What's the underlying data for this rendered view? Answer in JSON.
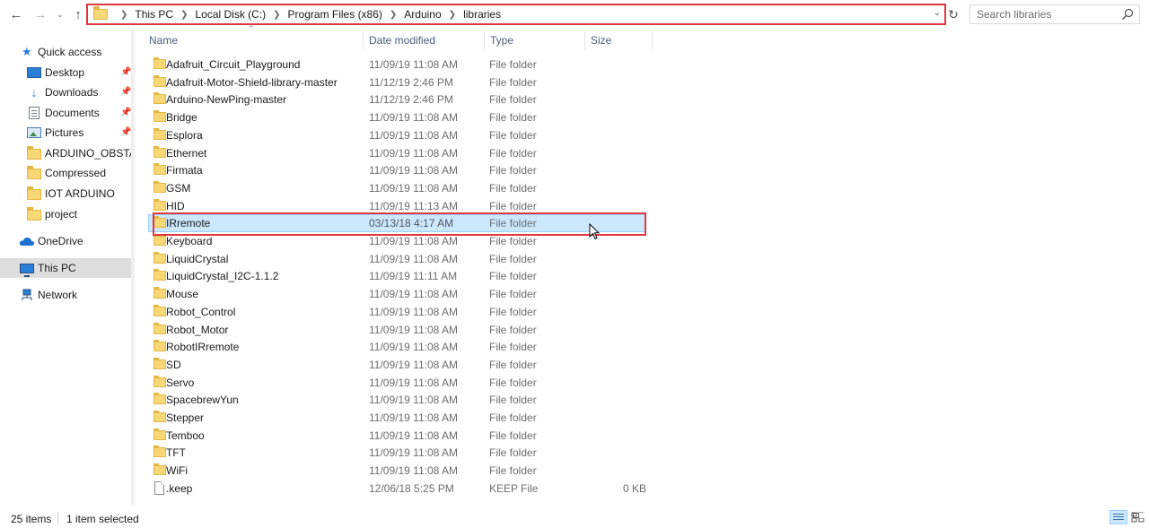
{
  "navigation": {
    "back_icon": "arrow-left-icon",
    "forward_icon": "arrow-right-icon",
    "recent_icon": "chevron-down-icon",
    "up_icon": "arrow-up-icon",
    "refresh_icon": "refresh-icon",
    "breadcrumbs": [
      "This PC",
      "Local Disk (C:)",
      "Program Files (x86)",
      "Arduino",
      "libraries"
    ],
    "search": {
      "placeholder": "Search libraries",
      "icon": "search-icon"
    }
  },
  "sidebar": {
    "items": [
      {
        "label": "Quick access",
        "icon": "star-icon",
        "pinned": false
      },
      {
        "label": "Desktop",
        "icon": "desktop-icon",
        "pinned": true
      },
      {
        "label": "Downloads",
        "icon": "download-arrow-icon",
        "pinned": true
      },
      {
        "label": "Documents",
        "icon": "documents-icon",
        "pinned": true
      },
      {
        "label": "Pictures",
        "icon": "pictures-icon",
        "pinned": true
      },
      {
        "label": "ARDUINO_OBSTACL",
        "icon": "folder-icon",
        "pinned": false
      },
      {
        "label": "Compressed",
        "icon": "folder-icon",
        "pinned": false
      },
      {
        "label": "IOT ARDUINO",
        "icon": "folder-icon",
        "pinned": false
      },
      {
        "label": "project",
        "icon": "folder-icon",
        "pinned": false
      },
      {
        "label": "OneDrive",
        "icon": "cloud-icon",
        "pinned": false
      },
      {
        "label": "This PC",
        "icon": "computer-icon",
        "pinned": false,
        "selected": true
      },
      {
        "label": "Network",
        "icon": "network-icon",
        "pinned": false
      }
    ]
  },
  "columns": {
    "name": "Name",
    "date": "Date modified",
    "type": "Type",
    "size": "Size"
  },
  "files": [
    {
      "name": "Adafruit_Circuit_Playground",
      "date": "11/09/19 11:08 AM",
      "type": "File folder",
      "size": ""
    },
    {
      "name": "Adafruit-Motor-Shield-library-master",
      "date": "11/12/19 2:46 PM",
      "type": "File folder",
      "size": ""
    },
    {
      "name": "Arduino-NewPing-master",
      "date": "11/12/19 2:46 PM",
      "type": "File folder",
      "size": ""
    },
    {
      "name": "Bridge",
      "date": "11/09/19 11:08 AM",
      "type": "File folder",
      "size": ""
    },
    {
      "name": "Esplora",
      "date": "11/09/19 11:08 AM",
      "type": "File folder",
      "size": ""
    },
    {
      "name": "Ethernet",
      "date": "11/09/19 11:08 AM",
      "type": "File folder",
      "size": ""
    },
    {
      "name": "Firmata",
      "date": "11/09/19 11:08 AM",
      "type": "File folder",
      "size": ""
    },
    {
      "name": "GSM",
      "date": "11/09/19 11:08 AM",
      "type": "File folder",
      "size": ""
    },
    {
      "name": "HID",
      "date": "11/09/19 11:13 AM",
      "type": "File folder",
      "size": ""
    },
    {
      "name": "IRremote",
      "date": "03/13/18 4:17 AM",
      "type": "File folder",
      "size": "",
      "selected": true
    },
    {
      "name": "Keyboard",
      "date": "11/09/19 11:08 AM",
      "type": "File folder",
      "size": ""
    },
    {
      "name": "LiquidCrystal",
      "date": "11/09/19 11:08 AM",
      "type": "File folder",
      "size": ""
    },
    {
      "name": "LiquidCrystal_I2C-1.1.2",
      "date": "11/09/19 11:11 AM",
      "type": "File folder",
      "size": ""
    },
    {
      "name": "Mouse",
      "date": "11/09/19 11:08 AM",
      "type": "File folder",
      "size": ""
    },
    {
      "name": "Robot_Control",
      "date": "11/09/19 11:08 AM",
      "type": "File folder",
      "size": ""
    },
    {
      "name": "Robot_Motor",
      "date": "11/09/19 11:08 AM",
      "type": "File folder",
      "size": ""
    },
    {
      "name": "RobotIRremote",
      "date": "11/09/19 11:08 AM",
      "type": "File folder",
      "size": ""
    },
    {
      "name": "SD",
      "date": "11/09/19 11:08 AM",
      "type": "File folder",
      "size": ""
    },
    {
      "name": "Servo",
      "date": "11/09/19 11:08 AM",
      "type": "File folder",
      "size": ""
    },
    {
      "name": "SpacebrewYun",
      "date": "11/09/19 11:08 AM",
      "type": "File folder",
      "size": ""
    },
    {
      "name": "Stepper",
      "date": "11/09/19 11:08 AM",
      "type": "File folder",
      "size": ""
    },
    {
      "name": "Temboo",
      "date": "11/09/19 11:08 AM",
      "type": "File folder",
      "size": ""
    },
    {
      "name": "TFT",
      "date": "11/09/19 11:08 AM",
      "type": "File folder",
      "size": ""
    },
    {
      "name": "WiFi",
      "date": "11/09/19 11:08 AM",
      "type": "File folder",
      "size": ""
    },
    {
      "name": ".keep",
      "date": "12/06/18 5:25 PM",
      "type": "KEEP File",
      "size": "0 KB",
      "is_file": true
    }
  ],
  "status": {
    "count": "25 items",
    "selection": "1 item selected"
  },
  "colors": {
    "selection": "#cce8ff",
    "annotation": "#e0383e",
    "folder": "#f8d775"
  }
}
